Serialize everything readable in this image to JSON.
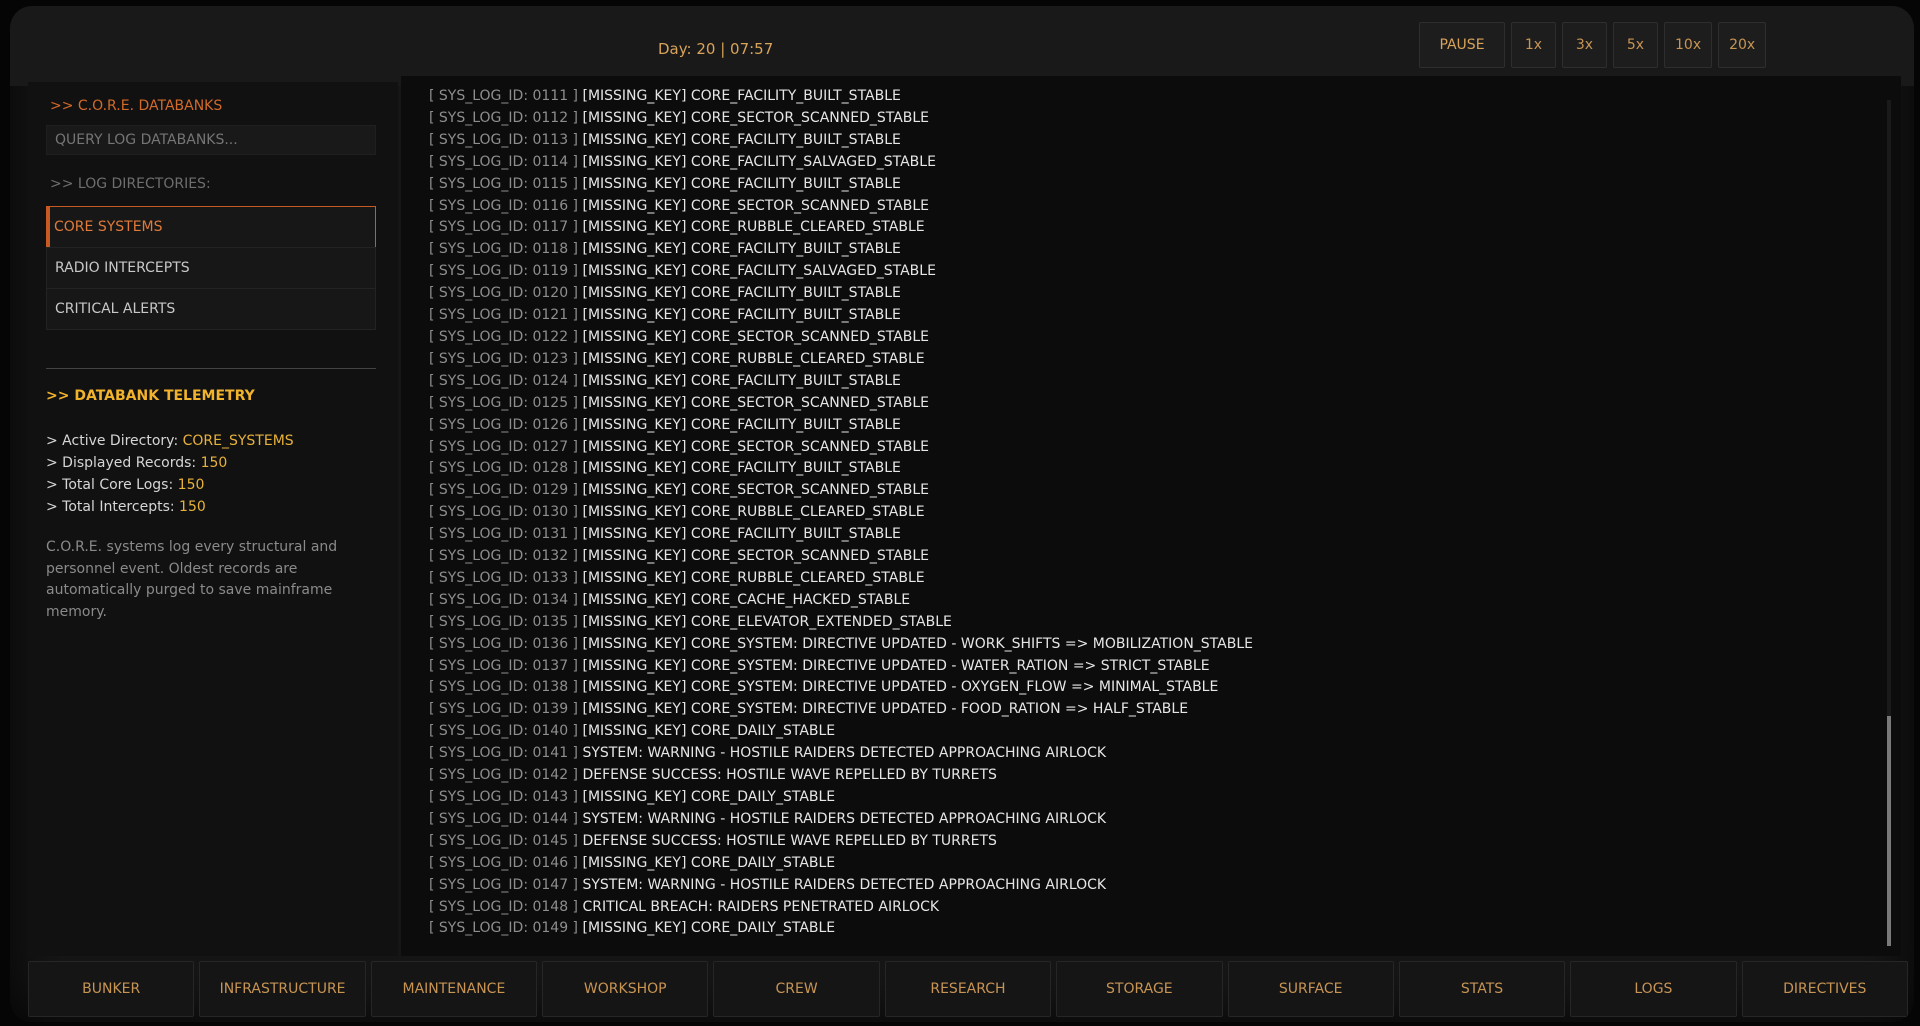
{
  "topbar": {
    "clock": "Day: 20 | 07:57",
    "speed_buttons": [
      "PAUSE",
      "1x",
      "3x",
      "5x",
      "10x",
      "20x"
    ]
  },
  "sidebar": {
    "title": ">> C.O.R.E. DATABANKS",
    "query_placeholder": "QUERY LOG DATABANKS...",
    "directories_label": ">> LOG DIRECTORIES:",
    "directories": [
      "CORE SYSTEMS",
      "RADIO INTERCEPTS",
      "CRITICAL ALERTS"
    ],
    "active_directory_index": 0,
    "telemetry_title": ">> DATABANK TELEMETRY",
    "telemetry": [
      {
        "label": "> Active Directory: ",
        "value": "CORE_SYSTEMS"
      },
      {
        "label": "> Displayed Records: ",
        "value": "150"
      },
      {
        "label": "> Total Core Logs: ",
        "value": "150"
      },
      {
        "label": "> Total Intercepts: ",
        "value": "150"
      }
    ],
    "description": "C.O.R.E. systems log every structural and personnel event. Oldest records are automatically purged to save mainframe memory."
  },
  "logs": [
    {
      "id": "[ SYS_LOG_ID: 0111 ]",
      "msg": "[MISSING_KEY] CORE_FACILITY_BUILT_STABLE"
    },
    {
      "id": "[ SYS_LOG_ID: 0112 ]",
      "msg": "[MISSING_KEY] CORE_SECTOR_SCANNED_STABLE"
    },
    {
      "id": "[ SYS_LOG_ID: 0113 ]",
      "msg": "[MISSING_KEY] CORE_FACILITY_BUILT_STABLE"
    },
    {
      "id": "[ SYS_LOG_ID: 0114 ]",
      "msg": "[MISSING_KEY] CORE_FACILITY_SALVAGED_STABLE"
    },
    {
      "id": "[ SYS_LOG_ID: 0115 ]",
      "msg": "[MISSING_KEY] CORE_FACILITY_BUILT_STABLE"
    },
    {
      "id": "[ SYS_LOG_ID: 0116 ]",
      "msg": "[MISSING_KEY] CORE_SECTOR_SCANNED_STABLE"
    },
    {
      "id": "[ SYS_LOG_ID: 0117 ]",
      "msg": "[MISSING_KEY] CORE_RUBBLE_CLEARED_STABLE"
    },
    {
      "id": "[ SYS_LOG_ID: 0118 ]",
      "msg": "[MISSING_KEY] CORE_FACILITY_BUILT_STABLE"
    },
    {
      "id": "[ SYS_LOG_ID: 0119 ]",
      "msg": "[MISSING_KEY] CORE_FACILITY_SALVAGED_STABLE"
    },
    {
      "id": "[ SYS_LOG_ID: 0120 ]",
      "msg": "[MISSING_KEY] CORE_FACILITY_BUILT_STABLE"
    },
    {
      "id": "[ SYS_LOG_ID: 0121 ]",
      "msg": "[MISSING_KEY] CORE_FACILITY_BUILT_STABLE"
    },
    {
      "id": "[ SYS_LOG_ID: 0122 ]",
      "msg": "[MISSING_KEY] CORE_SECTOR_SCANNED_STABLE"
    },
    {
      "id": "[ SYS_LOG_ID: 0123 ]",
      "msg": "[MISSING_KEY] CORE_RUBBLE_CLEARED_STABLE"
    },
    {
      "id": "[ SYS_LOG_ID: 0124 ]",
      "msg": "[MISSING_KEY] CORE_FACILITY_BUILT_STABLE"
    },
    {
      "id": "[ SYS_LOG_ID: 0125 ]",
      "msg": "[MISSING_KEY] CORE_SECTOR_SCANNED_STABLE"
    },
    {
      "id": "[ SYS_LOG_ID: 0126 ]",
      "msg": "[MISSING_KEY] CORE_FACILITY_BUILT_STABLE"
    },
    {
      "id": "[ SYS_LOG_ID: 0127 ]",
      "msg": "[MISSING_KEY] CORE_SECTOR_SCANNED_STABLE"
    },
    {
      "id": "[ SYS_LOG_ID: 0128 ]",
      "msg": "[MISSING_KEY] CORE_FACILITY_BUILT_STABLE"
    },
    {
      "id": "[ SYS_LOG_ID: 0129 ]",
      "msg": "[MISSING_KEY] CORE_SECTOR_SCANNED_STABLE"
    },
    {
      "id": "[ SYS_LOG_ID: 0130 ]",
      "msg": "[MISSING_KEY] CORE_RUBBLE_CLEARED_STABLE"
    },
    {
      "id": "[ SYS_LOG_ID: 0131 ]",
      "msg": "[MISSING_KEY] CORE_FACILITY_BUILT_STABLE"
    },
    {
      "id": "[ SYS_LOG_ID: 0132 ]",
      "msg": "[MISSING_KEY] CORE_SECTOR_SCANNED_STABLE"
    },
    {
      "id": "[ SYS_LOG_ID: 0133 ]",
      "msg": "[MISSING_KEY] CORE_RUBBLE_CLEARED_STABLE"
    },
    {
      "id": "[ SYS_LOG_ID: 0134 ]",
      "msg": "[MISSING_KEY] CORE_CACHE_HACKED_STABLE"
    },
    {
      "id": "[ SYS_LOG_ID: 0135 ]",
      "msg": "[MISSING_KEY] CORE_ELEVATOR_EXTENDED_STABLE"
    },
    {
      "id": "[ SYS_LOG_ID: 0136 ]",
      "msg": "[MISSING_KEY] CORE_SYSTEM: DIRECTIVE UPDATED - WORK_SHIFTS => MOBILIZATION_STABLE"
    },
    {
      "id": "[ SYS_LOG_ID: 0137 ]",
      "msg": "[MISSING_KEY] CORE_SYSTEM: DIRECTIVE UPDATED - WATER_RATION => STRICT_STABLE"
    },
    {
      "id": "[ SYS_LOG_ID: 0138 ]",
      "msg": "[MISSING_KEY] CORE_SYSTEM: DIRECTIVE UPDATED - OXYGEN_FLOW => MINIMAL_STABLE"
    },
    {
      "id": "[ SYS_LOG_ID: 0139 ]",
      "msg": "[MISSING_KEY] CORE_SYSTEM: DIRECTIVE UPDATED - FOOD_RATION => HALF_STABLE"
    },
    {
      "id": "[ SYS_LOG_ID: 0140 ]",
      "msg": "[MISSING_KEY] CORE_DAILY_STABLE"
    },
    {
      "id": "[ SYS_LOG_ID: 0141 ]",
      "msg": "SYSTEM: WARNING - HOSTILE RAIDERS DETECTED APPROACHING AIRLOCK"
    },
    {
      "id": "[ SYS_LOG_ID: 0142 ]",
      "msg": "DEFENSE SUCCESS: HOSTILE WAVE REPELLED BY TURRETS"
    },
    {
      "id": "[ SYS_LOG_ID: 0143 ]",
      "msg": "[MISSING_KEY] CORE_DAILY_STABLE"
    },
    {
      "id": "[ SYS_LOG_ID: 0144 ]",
      "msg": "SYSTEM: WARNING - HOSTILE RAIDERS DETECTED APPROACHING AIRLOCK"
    },
    {
      "id": "[ SYS_LOG_ID: 0145 ]",
      "msg": "DEFENSE SUCCESS: HOSTILE WAVE REPELLED BY TURRETS"
    },
    {
      "id": "[ SYS_LOG_ID: 0146 ]",
      "msg": "[MISSING_KEY] CORE_DAILY_STABLE"
    },
    {
      "id": "[ SYS_LOG_ID: 0147 ]",
      "msg": "SYSTEM: WARNING - HOSTILE RAIDERS DETECTED APPROACHING AIRLOCK"
    },
    {
      "id": "[ SYS_LOG_ID: 0148 ]",
      "msg": "CRITICAL BREACH: RAIDERS PENETRATED AIRLOCK"
    },
    {
      "id": "[ SYS_LOG_ID: 0149 ]",
      "msg": "[MISSING_KEY] CORE_DAILY_STABLE"
    }
  ],
  "bottom_nav": [
    "BUNKER",
    "INFRASTRUCTURE",
    "MAINTENANCE",
    "WORKSHOP",
    "CREW",
    "RESEARCH",
    "STORAGE",
    "SURFACE",
    "STATS",
    "LOGS",
    "DIRECTIVES"
  ],
  "colors": {
    "accent": "#c75a22",
    "amber": "#d8a35a",
    "telemetry": "#f2b32c"
  }
}
